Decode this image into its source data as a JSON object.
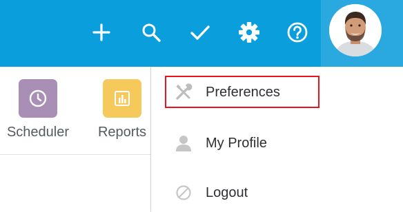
{
  "topbar": {
    "icons": [
      "plus-icon",
      "search-icon",
      "check-icon",
      "gear-icon",
      "help-icon"
    ],
    "bg_color": "#0a9fdc"
  },
  "apps": [
    {
      "label": "Scheduler",
      "icon": "clock-icon",
      "color": "#a98fb6"
    },
    {
      "label": "Reports",
      "icon": "bar-chart-icon",
      "color": "#f6c95d"
    }
  ],
  "menu": {
    "items": [
      {
        "label": "Preferences",
        "icon": "wrench-icon",
        "highlighted": true
      },
      {
        "label": "My Profile",
        "icon": "person-icon"
      },
      {
        "label": "Logout",
        "icon": "block-icon"
      }
    ]
  },
  "colors": {
    "highlight": "#e8141b",
    "accent": "#0a9fdc"
  }
}
